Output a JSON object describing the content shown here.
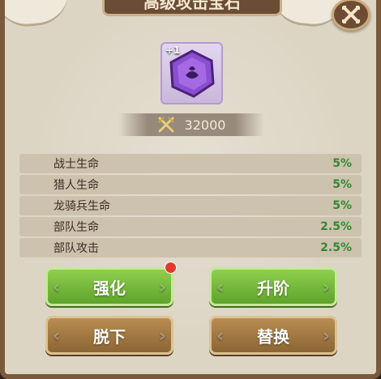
{
  "title": "高级攻击宝石",
  "gem": {
    "level_badge": "+1",
    "icon": "purple-gem-icon",
    "color": "#8a4fd0"
  },
  "power": {
    "icon": "crossed-swords-icon",
    "value": "32000"
  },
  "stats": [
    {
      "name": "战士生命",
      "value": "5%"
    },
    {
      "name": "猎人生命",
      "value": "5%"
    },
    {
      "name": "龙骑兵生命",
      "value": "5%"
    },
    {
      "name": "部队生命",
      "value": "2.5%"
    },
    {
      "name": "部队攻击",
      "value": "2.5%"
    }
  ],
  "buttons": {
    "strengthen": "强化",
    "upgrade": "升阶",
    "remove": "脱下",
    "replace": "替换"
  },
  "colors": {
    "green_value": "#2e8b2e",
    "green_button": "#6fb338",
    "brown_button": "#a37a42",
    "notification": "#e33a2f"
  }
}
